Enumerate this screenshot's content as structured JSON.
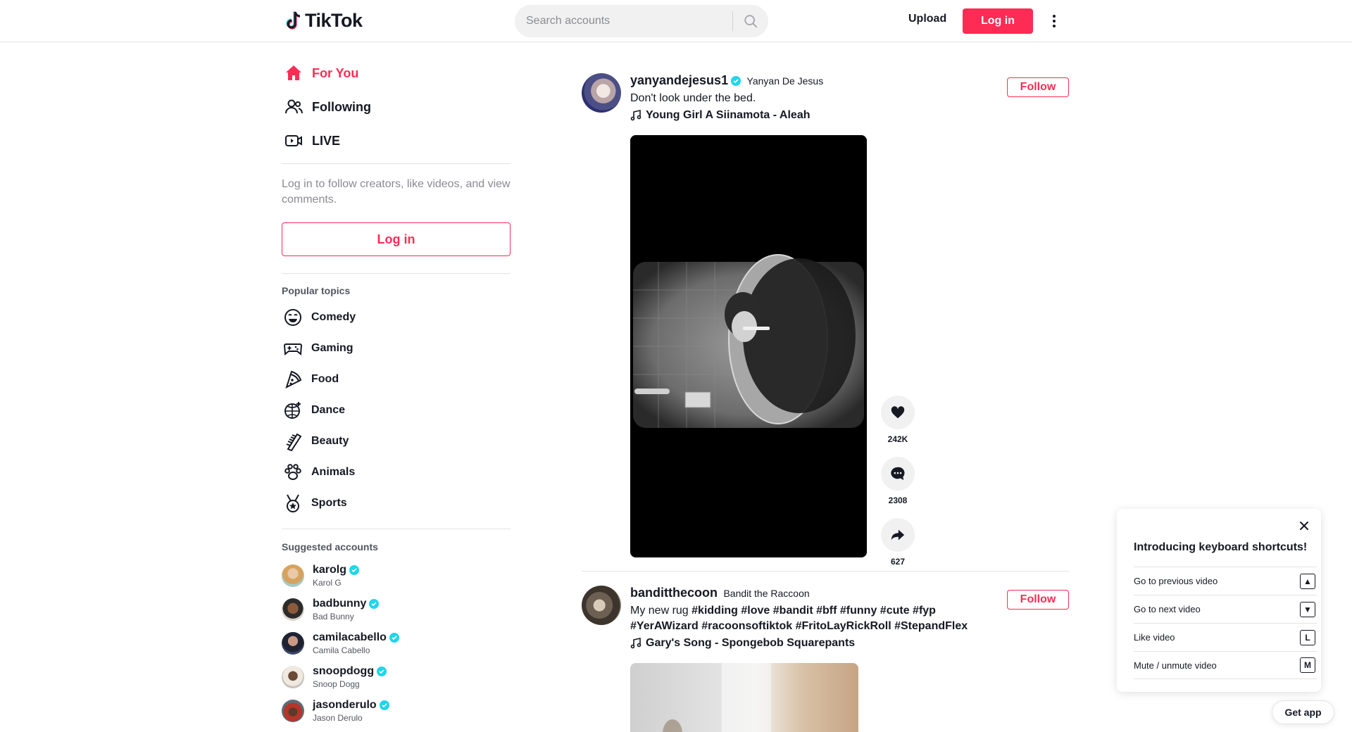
{
  "header": {
    "logo_text": "TikTok",
    "search_placeholder": "Search accounts",
    "upload_label": "Upload",
    "login_label": "Log in"
  },
  "sidebar": {
    "nav": [
      {
        "label": "For You",
        "icon": "home-icon",
        "active": true
      },
      {
        "label": "Following",
        "icon": "following-icon",
        "active": false
      },
      {
        "label": "LIVE",
        "icon": "live-icon",
        "active": false
      }
    ],
    "login_hint": "Log in to follow creators, like videos, and view comments.",
    "login_label": "Log in",
    "popular_title": "Popular topics",
    "topics": [
      {
        "label": "Comedy",
        "icon": "comedy-icon"
      },
      {
        "label": "Gaming",
        "icon": "gaming-icon"
      },
      {
        "label": "Food",
        "icon": "food-icon"
      },
      {
        "label": "Dance",
        "icon": "dance-icon"
      },
      {
        "label": "Beauty",
        "icon": "beauty-icon"
      },
      {
        "label": "Animals",
        "icon": "animals-icon"
      },
      {
        "label": "Sports",
        "icon": "sports-icon"
      }
    ],
    "suggested_title": "Suggested accounts",
    "accounts": [
      {
        "username": "karolg",
        "name": "Karol G",
        "verified": true
      },
      {
        "username": "badbunny",
        "name": "Bad Bunny",
        "verified": true
      },
      {
        "username": "camilacabello",
        "name": "Camila Cabello",
        "verified": true
      },
      {
        "username": "snoopdogg",
        "name": "Snoop Dogg",
        "verified": true
      },
      {
        "username": "jasonderulo",
        "name": "Jason Derulo",
        "verified": true
      }
    ]
  },
  "feed": {
    "posts": [
      {
        "username": "yanyandejesus1",
        "display_name": "Yanyan De Jesus",
        "verified": true,
        "description": "Don't look under the bed.",
        "hashtags": [],
        "music": "Young Girl A Siinamota - Aleah",
        "follow_label": "Follow",
        "likes": "242K",
        "comments": "2308",
        "shares": "627"
      },
      {
        "username": "banditthecoon",
        "display_name": "Bandit the Raccoon",
        "verified": false,
        "description": "My new rug",
        "hashtags": [
          "#kidding",
          "#love",
          "#bandit",
          "#bff",
          "#funny",
          "#cute",
          "#fyp",
          "#YerAWizard",
          "#racoonsoftiktok",
          "#FritoLayRickRoll",
          "#StepandFlex"
        ],
        "music": "Gary's Song - Spongebob Squarepants",
        "follow_label": "Follow"
      }
    ]
  },
  "keyboard_popup": {
    "title": "Introducing keyboard shortcuts!",
    "shortcuts": [
      {
        "label": "Go to previous video",
        "key": "▲"
      },
      {
        "label": "Go to next video",
        "key": "▼"
      },
      {
        "label": "Like video",
        "key": "L"
      },
      {
        "label": "Mute / unmute video",
        "key": "M"
      }
    ]
  },
  "get_app_label": "Get app",
  "colors": {
    "accent": "#fe2c55",
    "verified": "#20d5ec",
    "text": "#161823",
    "muted": "#8a8b91"
  }
}
